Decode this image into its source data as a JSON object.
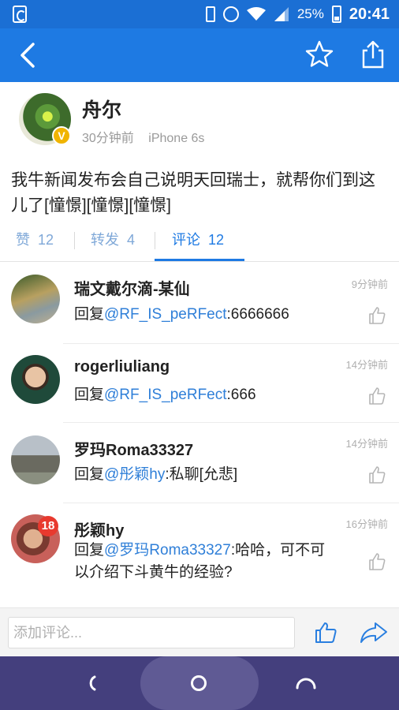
{
  "status_bar": {
    "battery_pct": "25%",
    "time": "20:41"
  },
  "post": {
    "author": "舟尔",
    "time_ago": "30分钟前",
    "device": "iPhone 6s",
    "verified_badge": "V",
    "content": "我牛新闻发布会自己说明天回瑞士，就帮你们到这儿了[憧憬][憧憬][憧憬]"
  },
  "tabs": [
    {
      "label": "赞",
      "count": "12"
    },
    {
      "label": "转发",
      "count": "4"
    },
    {
      "label": "评论",
      "count": "12"
    }
  ],
  "comments": [
    {
      "name": "瑞文戴尔滴-某仙",
      "time": "9分钟前",
      "prefix": "回复",
      "mention": "@RF_IS_peRFect",
      "text": ":6666666"
    },
    {
      "name": "rogerliuliang",
      "time": "14分钟前",
      "prefix": "回复",
      "mention": "@RF_IS_peRFect",
      "text": ":666"
    },
    {
      "name": "罗玛Roma33327",
      "time": "14分钟前",
      "prefix": "回复",
      "mention": "@彤颖hy",
      "text": ":私聊[允悲]"
    },
    {
      "name": "彤颖hy",
      "time": "16分钟前",
      "prefix": "回复",
      "mention": "@罗玛Roma33327",
      "text": ":哈哈，可不可以介绍下斗黄牛的经验?",
      "badge": "18"
    }
  ],
  "input_bar": {
    "placeholder": "添加评论..."
  },
  "colors": {
    "primary": "#1e7ae3",
    "link": "#2f7fd8",
    "nav_bar": "#443f7d"
  }
}
